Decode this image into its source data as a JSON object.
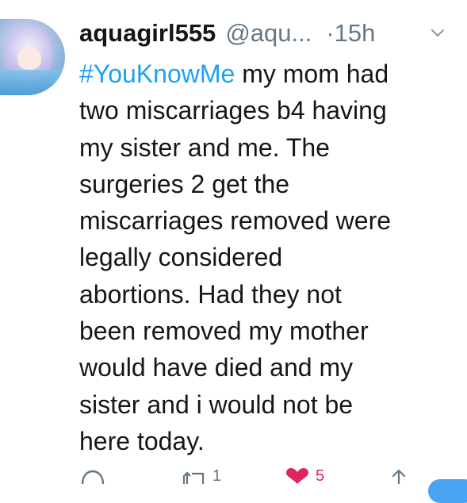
{
  "tweet": {
    "display_name": "aquagirl555",
    "handle": "@aqu...",
    "separator": "·",
    "time": "15h",
    "hashtag": "#YouKnowMe",
    "text": " my mom had\ntwo miscarriages b4 having\nmy sister and me. The\nsurgeries 2 get the\nmiscarriages removed were\nlegally considered\nabortions. Had they not\nbeen removed my mother\nwould have died and my\nsister and i would not be\nhere today."
  },
  "actions": {
    "retweet_count": "1",
    "like_count": "5"
  },
  "colors": {
    "hashtag": "#1da1f2",
    "like": "#e0245e",
    "muted": "#657786",
    "text": "#14171a"
  },
  "icons": [
    "avatar",
    "chevron-down-icon",
    "reply-icon",
    "retweet-icon",
    "heart-icon",
    "share-icon"
  ]
}
